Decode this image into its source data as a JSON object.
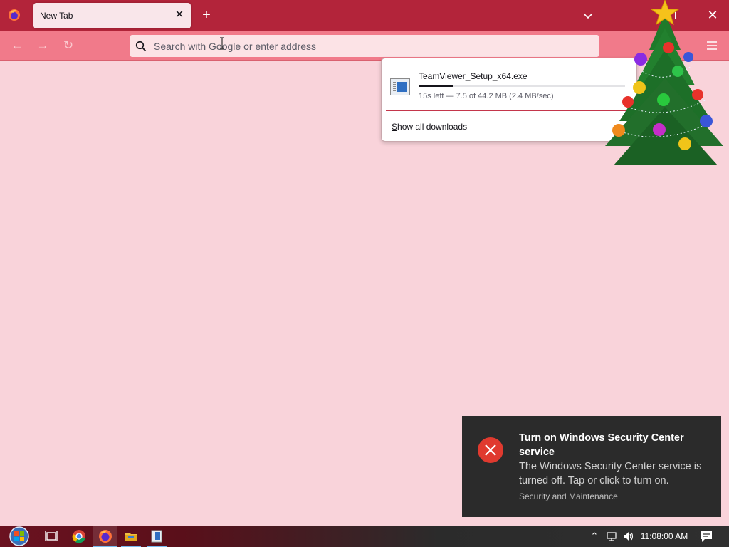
{
  "browser": {
    "tab": {
      "title": "New Tab",
      "close_glyph": "✕"
    },
    "new_tab_glyph": "+",
    "window_controls": {
      "minimize_glyph": "—",
      "close_glyph": "✕"
    },
    "nav": {
      "back_glyph": "←",
      "forward_glyph": "→",
      "reload_glyph": "↻"
    },
    "urlbar": {
      "placeholder": "Search with Google or enter address",
      "value": ""
    }
  },
  "downloads_panel": {
    "item": {
      "filename": "TeamViewer_Setup_x64.exe",
      "status": "15s left — 7.5 of 44.2 MB (2.4 MB/sec)",
      "progress_percent": 17
    },
    "show_all_prefix": "S",
    "show_all_rest": "how all downloads"
  },
  "toast": {
    "title": "Turn on Windows Security Center service",
    "body": "The Windows Security Center service is turned off. Tap or click to turn on.",
    "source": "Security and Maintenance",
    "icon": "error-x-icon",
    "icon_color": "#e03a2f"
  },
  "taskbar": {
    "clock": "11:08:00 AM",
    "tray_chevron_glyph": "⌃"
  },
  "colors": {
    "tabstrip": "#b3243a",
    "navbar": "#f17a8a",
    "page_background": "#f9d3da",
    "accent_separator": "#c4364b"
  }
}
